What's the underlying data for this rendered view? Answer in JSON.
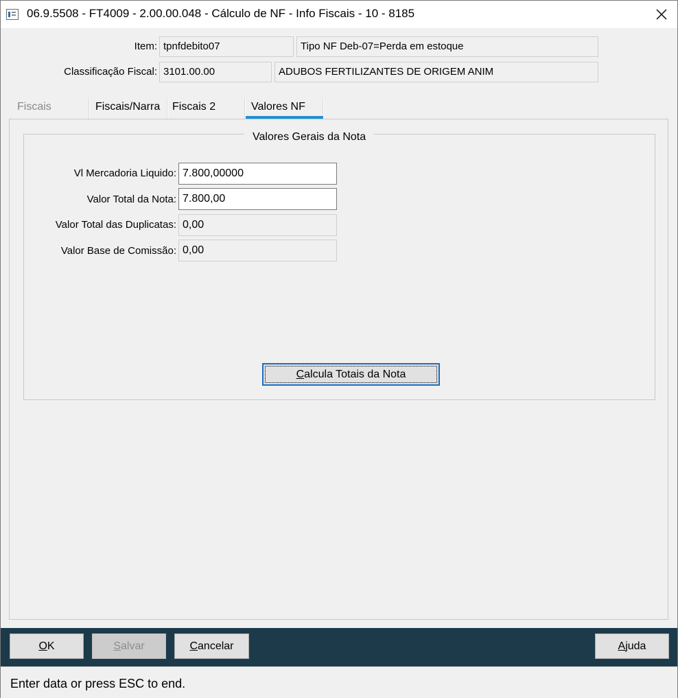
{
  "window": {
    "title": "06.9.5508 - FT4009 - 2.00.00.048 - Cálculo de NF - Info Fiscais - 10 - 8185"
  },
  "header": {
    "item_label": "Item:",
    "item_code": "tpnfdebito07",
    "item_desc": "Tipo NF Deb-07=Perda em estoque",
    "class_label": "Classificação Fiscal:",
    "class_code": "3101.00.00",
    "class_desc": "ADUBOS FERTILIZANTES DE ORIGEM ANIM"
  },
  "tabs": [
    {
      "label": "Fiscais",
      "enabled": false
    },
    {
      "label": "Fiscais/Narra",
      "enabled": true
    },
    {
      "label": "Fiscais 2",
      "enabled": true
    },
    {
      "label": "Valores NF",
      "enabled": true,
      "active": true
    }
  ],
  "group": {
    "title": "Valores Gerais da Nota",
    "fields": [
      {
        "label": "Vl Mercadoria Liquido:",
        "value": "7.800,00000",
        "editable": true
      },
      {
        "label": "Valor Total da Nota:",
        "value": "7.800,00",
        "editable": true
      },
      {
        "label": "Valor Total das Duplicatas:",
        "value": "0,00",
        "editable": false
      },
      {
        "label": "Valor Base de Comissão:",
        "value": "0,00",
        "editable": false
      }
    ],
    "calc_button": "Calcula Totais da Nota"
  },
  "buttons": {
    "ok": "OK",
    "save": "Salvar",
    "cancel": "Cancelar",
    "help": "Ajuda"
  },
  "status": "Enter data or press ESC to end.",
  "colors": {
    "tab_accent": "#1e90d6",
    "bottom_bar": "#1c3a4a",
    "focus_border": "#1a6ec6"
  }
}
